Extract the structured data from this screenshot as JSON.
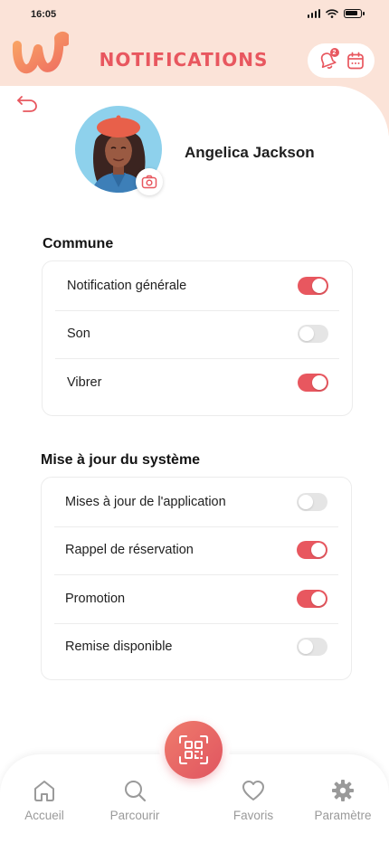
{
  "status_bar": {
    "time": "16:05"
  },
  "header": {
    "title": "NOTIFICATIONS",
    "notification_badge": "2",
    "icons": [
      "back-arrow-icon",
      "bell-icon",
      "calendar-icon"
    ]
  },
  "profile": {
    "name": "Angelica Jackson"
  },
  "sections": [
    {
      "title": "Commune",
      "items": [
        {
          "label": "Notification générale",
          "enabled": true
        },
        {
          "label": "Son",
          "enabled": false
        },
        {
          "label": "Vibrer",
          "enabled": true
        }
      ]
    },
    {
      "title": "Mise à jour du système",
      "items": [
        {
          "label": "Mises à jour de l'application",
          "enabled": false
        },
        {
          "label": "Rappel de réservation",
          "enabled": true
        },
        {
          "label": "Promotion",
          "enabled": true
        },
        {
          "label": "Remise disponible",
          "enabled": false
        }
      ]
    }
  ],
  "bottom_nav": {
    "items": [
      {
        "label": "Accueil",
        "icon": "home-icon"
      },
      {
        "label": "Parcourir",
        "icon": "search-icon"
      },
      {
        "label": "Favoris",
        "icon": "heart-icon"
      },
      {
        "label": "Paramètre",
        "icon": "gear-icon"
      }
    ],
    "center_button_icon": "qr-scan-icon"
  },
  "colors": {
    "accent": "#e8575f",
    "header_bg": "#fbe3d8",
    "toggle_off": "#e5e5e5"
  }
}
